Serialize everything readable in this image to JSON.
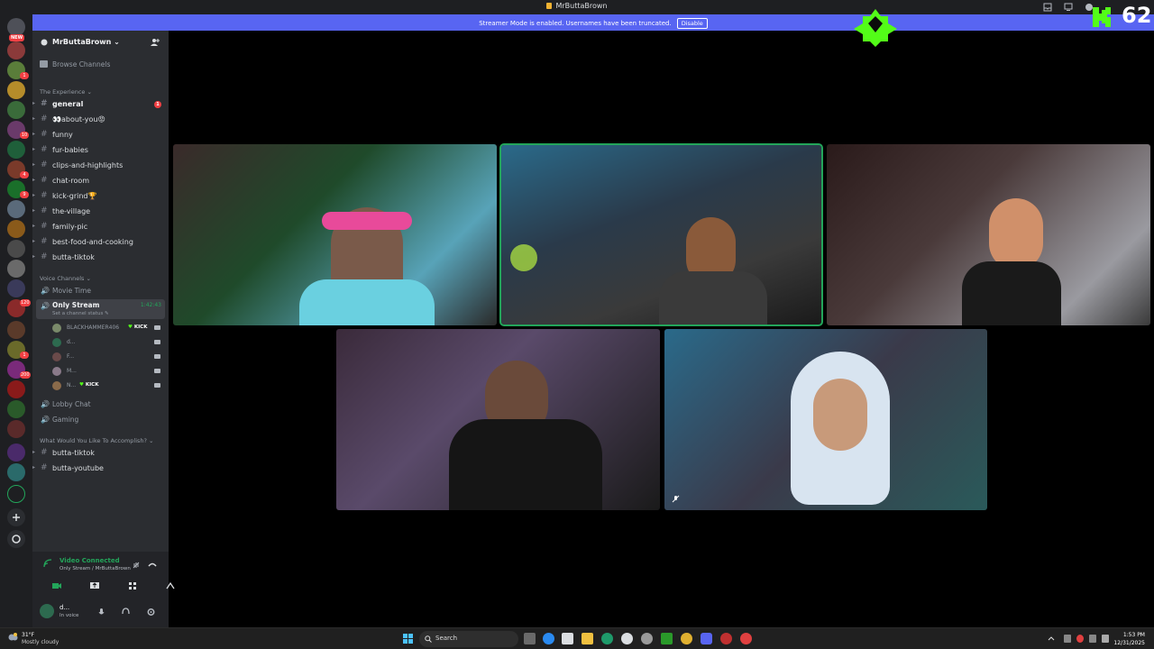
{
  "window": {
    "title": "MrButtaBrown"
  },
  "banner": {
    "message": "Streamer Mode is enabled. Usernames have been truncated.",
    "button": "Disable"
  },
  "rail": {
    "new_badge": "NEW",
    "badges": [
      "1",
      "10",
      "4",
      "9",
      "120",
      "1",
      "200"
    ]
  },
  "server": {
    "name": "MrButtaBrown",
    "browse": "Browse Channels"
  },
  "categories": {
    "experience": "The Experience",
    "voice": "Voice Channels",
    "accomplish": "What Would You Like To Accomplish?"
  },
  "text_channels": [
    {
      "label": "general",
      "unread": "1"
    },
    {
      "label": "👀about-you😡"
    },
    {
      "label": "funny"
    },
    {
      "label": "fur-babies"
    },
    {
      "label": "clips-and-highlights"
    },
    {
      "label": "chat-room"
    },
    {
      "label": "kick-grind🏆"
    },
    {
      "label": "the-village"
    },
    {
      "label": "family-pic"
    },
    {
      "label": "best-food-and-cooking"
    },
    {
      "label": "butta-tiktok"
    }
  ],
  "voice_channels": {
    "movie_time": "Movie Time",
    "only_stream": {
      "label": "Only Stream",
      "status": "Set a channel status ✎",
      "timer": "1:42:43"
    },
    "members": [
      {
        "name": "BLACKHAMMER406",
        "kick": "KICK"
      },
      {
        "name": "d..."
      },
      {
        "name": "F..."
      },
      {
        "name": "M..."
      },
      {
        "name": "N...",
        "kick": "KICK"
      }
    ],
    "lobby": "Lobby Chat",
    "gaming": "Gaming"
  },
  "accomplish_channels": [
    "butta-tiktok",
    "butta-youtube"
  ],
  "voice_panel": {
    "state": "Video Connected",
    "location": "Only Stream / MrButtaBrown"
  },
  "user_panel": {
    "name": "d...",
    "status": "In voice"
  },
  "kick_overlay": {
    "count": "62",
    "color": "#53fc18"
  },
  "taskbar": {
    "weather_temp": "31°F",
    "weather_cond": "Mostly cloudy",
    "search": "Search",
    "time": "1:53 PM",
    "date": "12/31/2025"
  },
  "colors": {
    "accent": "#5865f2",
    "speaking": "#23a55a",
    "unread": "#f23f43"
  }
}
